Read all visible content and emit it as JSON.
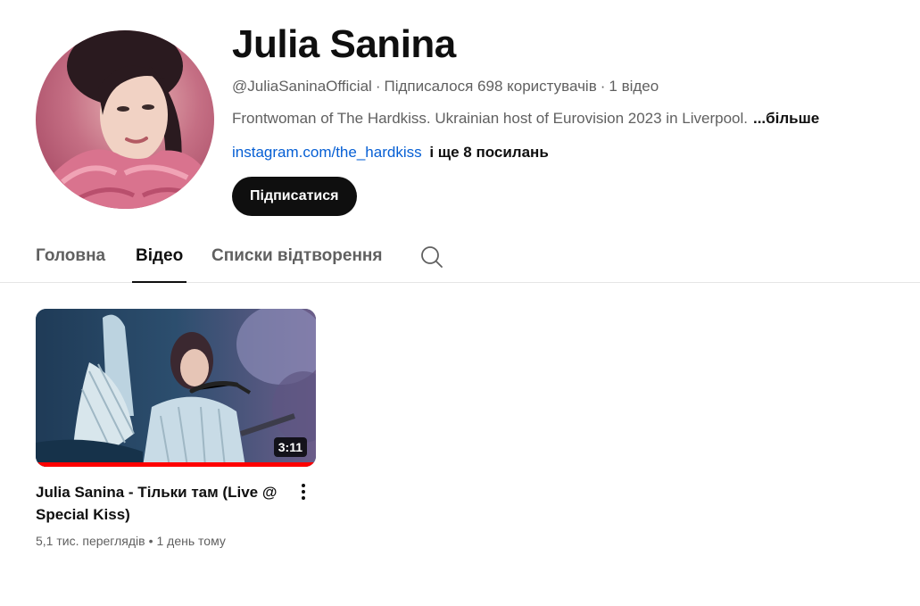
{
  "channel": {
    "name": "Julia Sanina",
    "handle": "@JuliaSaninaOfficial",
    "subscribers": "Підписалося 698 користувачів",
    "video_count": "1 відео",
    "description": "Frontwoman of The Hardkiss. Ukrainian host of Eurovision 2023 in Liverpool.",
    "more_label": "...більше",
    "link": "instagram.com/the_hardkiss",
    "more_links": "і ще 8 посилань",
    "subscribe_label": "Підписатися"
  },
  "tabs": [
    {
      "label": "Головна",
      "active": false
    },
    {
      "label": "Відео",
      "active": true
    },
    {
      "label": "Списки відтворення",
      "active": false
    }
  ],
  "search_icon": "search-icon",
  "videos": [
    {
      "title": "Julia Sanina - Тільки там (Live @ Special Kiss)",
      "duration": "3:11",
      "views": "5,1 тис. переглядів",
      "age": "1 день тому",
      "watched_fraction": 1.0
    }
  ],
  "colors": {
    "link": "#065fd4",
    "subscribe_bg": "#0f0f0f",
    "progress": "#ff0000"
  }
}
